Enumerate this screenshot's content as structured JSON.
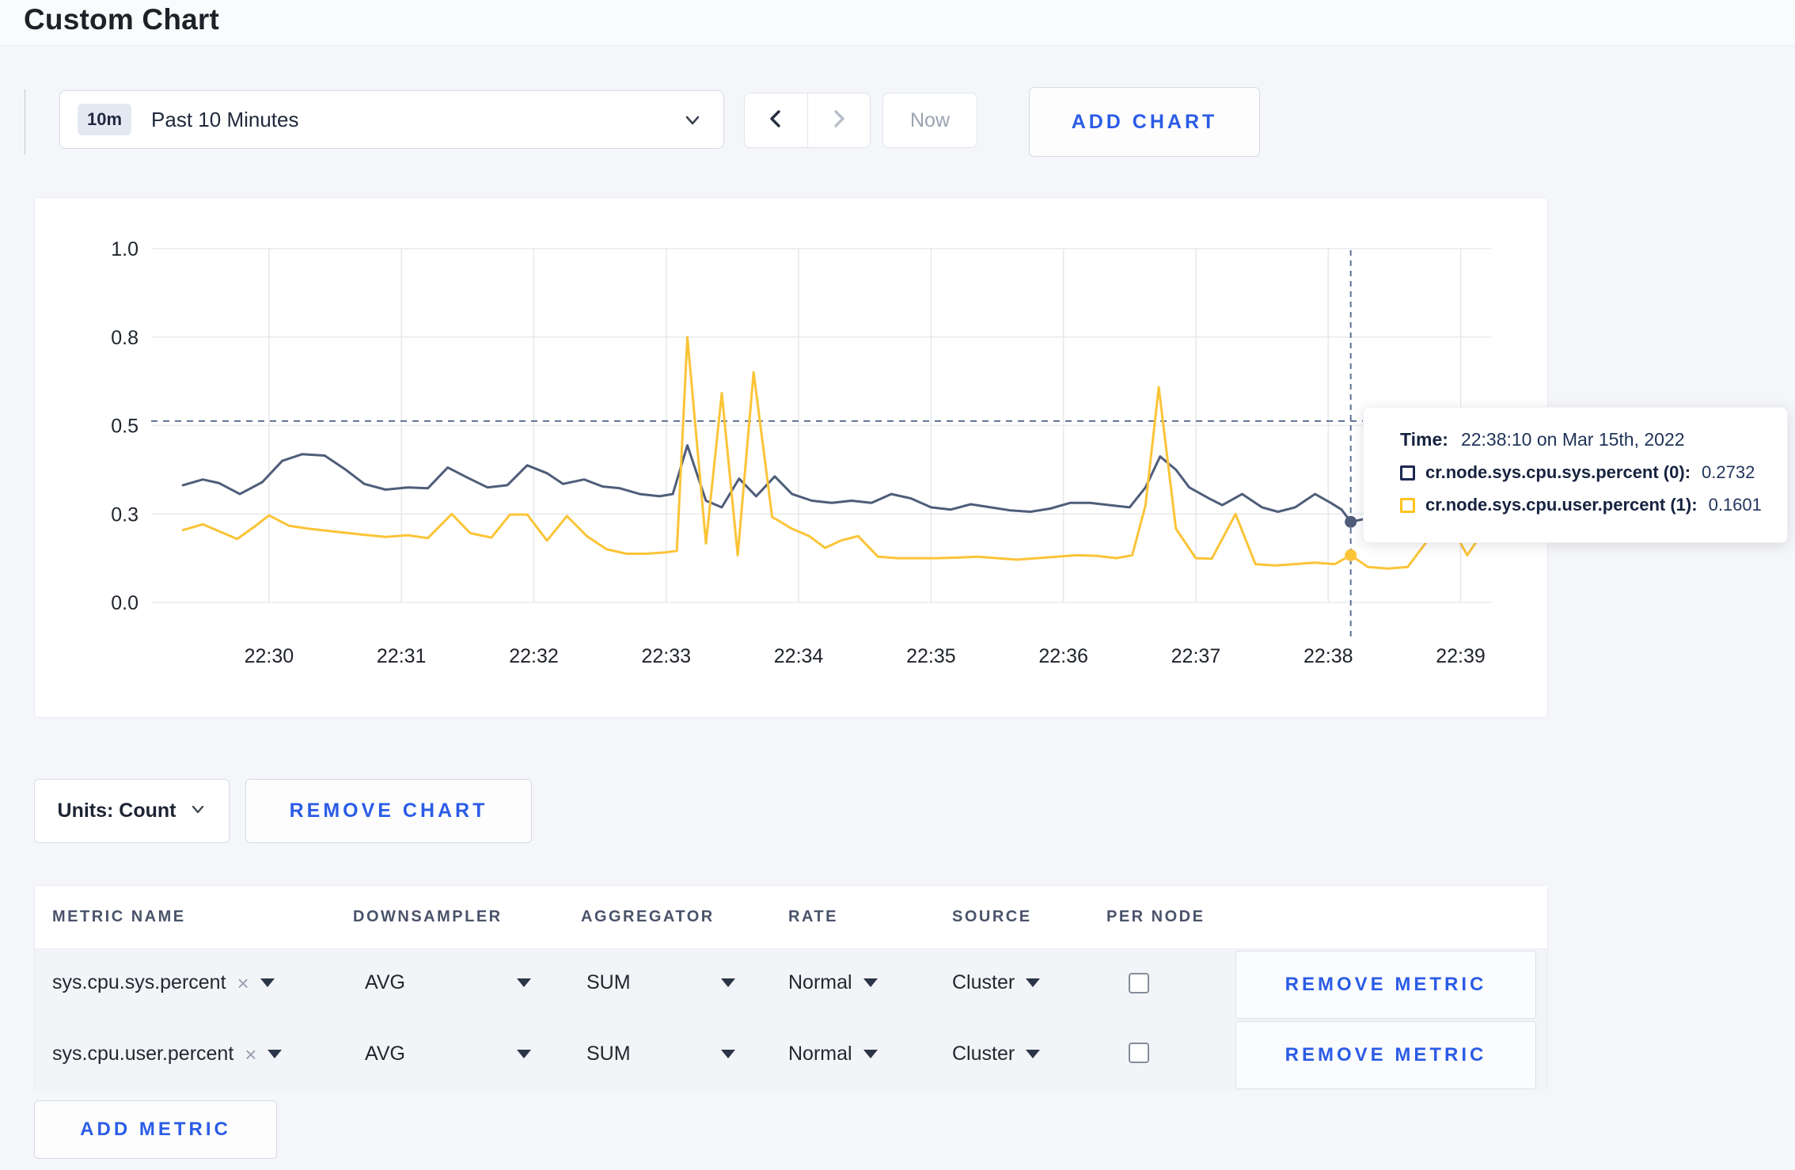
{
  "page": {
    "title": "Custom Chart"
  },
  "toolbar": {
    "time_range": {
      "badge": "10m",
      "label": "Past 10 Minutes"
    },
    "now_label": "Now",
    "add_chart_label": "ADD CHART"
  },
  "chart_controls": {
    "units_label": "Units: Count",
    "remove_chart_label": "REMOVE CHART"
  },
  "tooltip": {
    "time_label": "Time:",
    "time_value": "22:38:10 on Mar 15th, 2022",
    "rows": [
      {
        "label": "cr.node.sys.cpu.sys.percent (0):",
        "value": "0.2732",
        "color": "#1c2951"
      },
      {
        "label": "cr.node.sys.cpu.user.percent (1):",
        "value": "0.1601",
        "color": "#ffc31e"
      }
    ]
  },
  "metrics_table": {
    "columns": [
      "METRIC NAME",
      "DOWNSAMPLER",
      "AGGREGATOR",
      "RATE",
      "SOURCE",
      "PER NODE"
    ],
    "rows": [
      {
        "metric": "sys.cpu.sys.percent",
        "downsampler": "AVG",
        "aggregator": "SUM",
        "rate": "Normal",
        "source": "Cluster",
        "per_node_checked": false
      },
      {
        "metric": "sys.cpu.user.percent",
        "downsampler": "AVG",
        "aggregator": "SUM",
        "rate": "Normal",
        "source": "Cluster",
        "per_node_checked": false
      }
    ],
    "remove_metric_label": "REMOVE METRIC",
    "add_metric_label": "ADD METRIC"
  },
  "icons": {
    "remove_tag": "×"
  },
  "chart_data": {
    "type": "line",
    "title": "",
    "xlabel": "",
    "ylabel": "",
    "grid": true,
    "x_tick_values": [
      30,
      31,
      32,
      33,
      34,
      35,
      36,
      37,
      38,
      39
    ],
    "x_tick_labels": [
      "22:30",
      "22:31",
      "22:32",
      "22:33",
      "22:34",
      "22:35",
      "22:36",
      "22:37",
      "22:38",
      "22:39"
    ],
    "x_domain_minutes": [
      29.11,
      39.23
    ],
    "y_tick_values": [
      0.0,
      0.3,
      0.5,
      0.8,
      1.0
    ],
    "y_tick_labels": [
      "0.0",
      "0.3",
      "0.5",
      "0.8",
      "1.0"
    ],
    "y_axis_layout": "ticks evenly spaced, piecewise-linear between tick values",
    "series": [
      {
        "name": "cr.node.sys.cpu.sys.percent (0)",
        "color": "#4f5d7a",
        "points": [
          [
            29.35,
            0.365
          ],
          [
            29.5,
            0.378
          ],
          [
            29.62,
            0.37
          ],
          [
            29.78,
            0.345
          ],
          [
            29.95,
            0.372
          ],
          [
            30.1,
            0.42
          ],
          [
            30.25,
            0.435
          ],
          [
            30.42,
            0.432
          ],
          [
            30.58,
            0.4
          ],
          [
            30.72,
            0.368
          ],
          [
            30.88,
            0.355
          ],
          [
            31.05,
            0.36
          ],
          [
            31.2,
            0.358
          ],
          [
            31.35,
            0.405
          ],
          [
            31.5,
            0.382
          ],
          [
            31.65,
            0.36
          ],
          [
            31.8,
            0.365
          ],
          [
            31.95,
            0.41
          ],
          [
            32.1,
            0.392
          ],
          [
            32.22,
            0.368
          ],
          [
            32.38,
            0.378
          ],
          [
            32.52,
            0.362
          ],
          [
            32.65,
            0.358
          ],
          [
            32.8,
            0.345
          ],
          [
            32.95,
            0.34
          ],
          [
            33.05,
            0.345
          ],
          [
            33.16,
            0.455
          ],
          [
            33.3,
            0.33
          ],
          [
            33.42,
            0.315
          ],
          [
            33.55,
            0.38
          ],
          [
            33.68,
            0.34
          ],
          [
            33.82,
            0.385
          ],
          [
            33.95,
            0.345
          ],
          [
            34.1,
            0.33
          ],
          [
            34.25,
            0.325
          ],
          [
            34.4,
            0.33
          ],
          [
            34.55,
            0.325
          ],
          [
            34.7,
            0.345
          ],
          [
            34.85,
            0.335
          ],
          [
            35.0,
            0.315
          ],
          [
            35.15,
            0.31
          ],
          [
            35.3,
            0.322
          ],
          [
            35.45,
            0.315
          ],
          [
            35.6,
            0.308
          ],
          [
            35.75,
            0.305
          ],
          [
            35.9,
            0.312
          ],
          [
            36.05,
            0.325
          ],
          [
            36.2,
            0.325
          ],
          [
            36.35,
            0.32
          ],
          [
            36.5,
            0.315
          ],
          [
            36.62,
            0.36
          ],
          [
            36.73,
            0.43
          ],
          [
            36.85,
            0.4
          ],
          [
            36.95,
            0.36
          ],
          [
            37.1,
            0.335
          ],
          [
            37.2,
            0.32
          ],
          [
            37.35,
            0.345
          ],
          [
            37.5,
            0.315
          ],
          [
            37.62,
            0.305
          ],
          [
            37.75,
            0.315
          ],
          [
            37.9,
            0.345
          ],
          [
            38.02,
            0.325
          ],
          [
            38.1,
            0.31
          ],
          [
            38.17,
            0.2732
          ],
          [
            38.35,
            0.29
          ],
          [
            38.55,
            0.3
          ],
          [
            38.75,
            0.295
          ],
          [
            38.95,
            0.3
          ],
          [
            39.15,
            0.3
          ]
        ]
      },
      {
        "name": "cr.node.sys.cpu.user.percent (1)",
        "color": "#fbc437",
        "points": [
          [
            29.35,
            0.245
          ],
          [
            29.5,
            0.265
          ],
          [
            29.63,
            0.24
          ],
          [
            29.76,
            0.215
          ],
          [
            29.9,
            0.26
          ],
          [
            30.0,
            0.295
          ],
          [
            30.15,
            0.26
          ],
          [
            30.3,
            0.25
          ],
          [
            30.5,
            0.24
          ],
          [
            30.7,
            0.23
          ],
          [
            30.88,
            0.222
          ],
          [
            31.05,
            0.228
          ],
          [
            31.2,
            0.218
          ],
          [
            31.38,
            0.3
          ],
          [
            31.52,
            0.235
          ],
          [
            31.68,
            0.22
          ],
          [
            31.82,
            0.298
          ],
          [
            31.95,
            0.298
          ],
          [
            32.1,
            0.21
          ],
          [
            32.25,
            0.293
          ],
          [
            32.4,
            0.225
          ],
          [
            32.55,
            0.18
          ],
          [
            32.7,
            0.165
          ],
          [
            32.85,
            0.165
          ],
          [
            33.0,
            0.17
          ],
          [
            33.08,
            0.175
          ],
          [
            33.16,
            0.8
          ],
          [
            33.3,
            0.2
          ],
          [
            33.42,
            0.61
          ],
          [
            33.54,
            0.16
          ],
          [
            33.66,
            0.68
          ],
          [
            33.8,
            0.29
          ],
          [
            33.95,
            0.25
          ],
          [
            34.08,
            0.225
          ],
          [
            34.2,
            0.185
          ],
          [
            34.32,
            0.21
          ],
          [
            34.45,
            0.225
          ],
          [
            34.6,
            0.155
          ],
          [
            34.75,
            0.15
          ],
          [
            34.9,
            0.15
          ],
          [
            35.05,
            0.15
          ],
          [
            35.2,
            0.152
          ],
          [
            35.35,
            0.155
          ],
          [
            35.5,
            0.15
          ],
          [
            35.65,
            0.145
          ],
          [
            35.8,
            0.15
          ],
          [
            35.95,
            0.155
          ],
          [
            36.1,
            0.16
          ],
          [
            36.25,
            0.158
          ],
          [
            36.4,
            0.15
          ],
          [
            36.52,
            0.16
          ],
          [
            36.62,
            0.32
          ],
          [
            36.72,
            0.63
          ],
          [
            36.85,
            0.25
          ],
          [
            37.0,
            0.15
          ],
          [
            37.12,
            0.148
          ],
          [
            37.3,
            0.3
          ],
          [
            37.45,
            0.13
          ],
          [
            37.6,
            0.125
          ],
          [
            37.75,
            0.13
          ],
          [
            37.9,
            0.135
          ],
          [
            38.05,
            0.13
          ],
          [
            38.17,
            0.1601
          ],
          [
            38.3,
            0.12
          ],
          [
            38.45,
            0.115
          ],
          [
            38.6,
            0.12
          ],
          [
            38.75,
            0.21
          ],
          [
            38.9,
            0.28
          ],
          [
            39.05,
            0.16
          ],
          [
            39.2,
            0.26
          ]
        ]
      }
    ],
    "hover": {
      "time_minute": 38.17,
      "h_guide_value": 0.515,
      "markers": [
        {
          "series": 0,
          "value": 0.2732
        },
        {
          "series": 1,
          "value": 0.1601
        }
      ]
    }
  }
}
